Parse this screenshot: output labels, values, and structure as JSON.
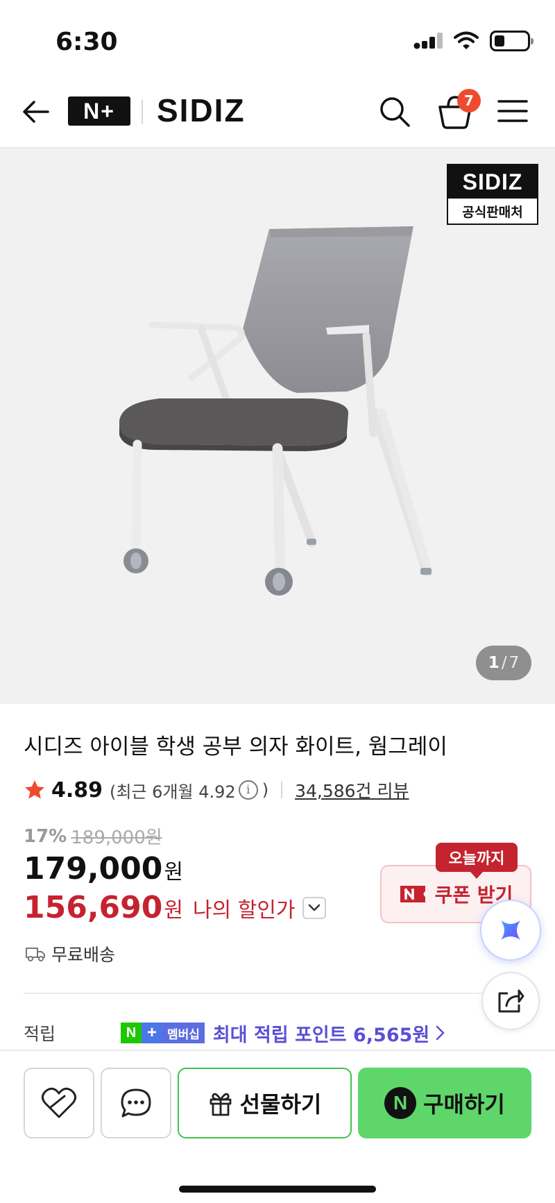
{
  "status_bar": {
    "time": "6:30",
    "icons": [
      "signal-icon",
      "wifi-icon",
      "battery-icon"
    ]
  },
  "header": {
    "back_icon": "back-arrow-icon",
    "np_badge": "N+",
    "brand": "SIDIZ",
    "search_icon": "search-icon",
    "cart_icon": "cart-icon",
    "cart_count": "7",
    "menu_icon": "menu-icon"
  },
  "gallery": {
    "official_badge": {
      "brand": "SIDIZ",
      "label": "공식판매처"
    },
    "current_page": "1",
    "separator": "/",
    "total_pages": "7"
  },
  "product": {
    "title": "시디즈 아이블 학생 공부 의자 화이트, 웜그레이",
    "rating": "4.89",
    "rating_recent_prefix": "(최근 6개월 4.92",
    "rating_recent_suffix": ")",
    "info_symbol": "i",
    "review_count": "34,586건 리뷰",
    "discount_rate": "17%",
    "original_price": "189,000원",
    "price": "179,000",
    "price_unit": "원",
    "my_price": "156,690",
    "my_price_unit": "원",
    "my_price_label": "나의 할인가",
    "shipping": "무료배송"
  },
  "coupon": {
    "tag": "오늘까지",
    "label": "쿠폰 받기"
  },
  "points": {
    "label": "적립",
    "membership_badge": "멤버십",
    "text": "최대 적립 포인트 6,565원"
  },
  "bottom_bar": {
    "gift_label": "선물하기",
    "buy_label": "구매하기",
    "buy_icon_letter": "N"
  },
  "colors": {
    "accent_red": "#c4232f",
    "naver_green": "#5fd66a",
    "points_purple": "#5b4fd6",
    "badge_orange": "#f04a2e"
  }
}
